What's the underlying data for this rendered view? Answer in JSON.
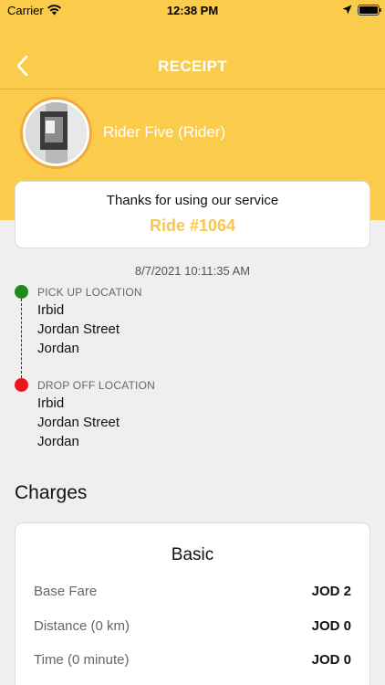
{
  "status_bar": {
    "carrier": "Carrier",
    "time": "12:38 PM"
  },
  "nav": {
    "title": "RECEIPT"
  },
  "rider": {
    "name": "Rider Five (Rider)"
  },
  "thanks_card": {
    "message": "Thanks for using our service",
    "ride_number": "Ride #1064"
  },
  "ride_datetime": "8/7/2021 10:11:35 AM",
  "pickup": {
    "label": "PICK UP LOCATION",
    "lines": [
      "Irbid",
      "Jordan Street",
      "Jordan"
    ]
  },
  "dropoff": {
    "label": "DROP OFF LOCATION",
    "lines": [
      "Irbid",
      "Jordan Street",
      "Jordan"
    ]
  },
  "charges": {
    "heading": "Charges",
    "plan": "Basic",
    "rows": [
      {
        "label": "Base Fare",
        "value": "JOD 2"
      },
      {
        "label": "Distance (0 km)",
        "value": "JOD 0"
      },
      {
        "label": "Time (0 minute)",
        "value": "JOD 0"
      }
    ]
  },
  "colors": {
    "header": "#fbcb4c",
    "accent": "#f8c74f",
    "pickup_dot": "#1d8a1d",
    "dropoff_dot": "#e8171b"
  }
}
